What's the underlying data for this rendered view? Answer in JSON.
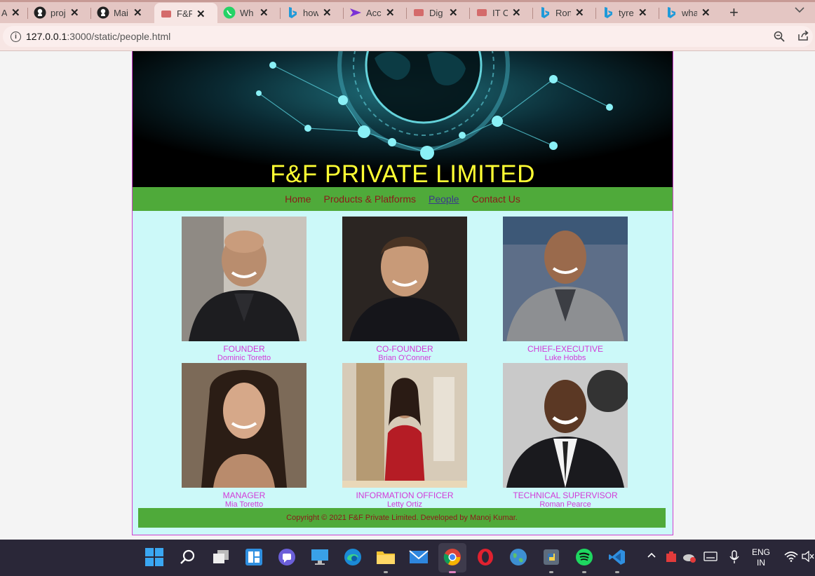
{
  "browser": {
    "tabs": [
      {
        "title": "A",
        "favicon": "generic-icon"
      },
      {
        "title": "proj",
        "favicon": "github-icon"
      },
      {
        "title": "Mai",
        "favicon": "github-icon"
      },
      {
        "title": "F&F",
        "favicon": "site-icon",
        "active": true
      },
      {
        "title": "Wh",
        "favicon": "whatsapp-icon"
      },
      {
        "title": "how",
        "favicon": "bing-icon"
      },
      {
        "title": "Acc",
        "favicon": "visual-studio-icon"
      },
      {
        "title": "Dig",
        "favicon": "site-icon"
      },
      {
        "title": "IT C",
        "favicon": "site-icon"
      },
      {
        "title": "Ron",
        "favicon": "bing-icon"
      },
      {
        "title": "tyre",
        "favicon": "bing-icon"
      },
      {
        "title": "wha",
        "favicon": "bing-icon"
      }
    ],
    "url_host": "127.0.0.1",
    "url_path": ":3000/static/people.html"
  },
  "page": {
    "company_title": "F&F PRIVATE LIMITED",
    "nav": [
      "Home",
      "Products & Platforms",
      "People",
      "Contact Us"
    ],
    "current_nav": "People",
    "people": [
      {
        "role": "FOUNDER",
        "name": "Dominic Toretto"
      },
      {
        "role": "CO-FOUNDER",
        "name": "Brian O'Conner"
      },
      {
        "role": "CHIEF-EXECUTIVE",
        "name": "Luke Hobbs"
      },
      {
        "role": "MANAGER",
        "name": "Mia Toretto"
      },
      {
        "role": "INFORMATION OFFICER",
        "name": "Letty Ortiz"
      },
      {
        "role": "TECHNICAL SUPERVISOR",
        "name": "Roman Pearce"
      }
    ],
    "footer": "Copyright © 2021 F&F Private Limited. Developed by Manoj Kumar."
  },
  "taskbar": {
    "apps": [
      "start-icon",
      "search-icon",
      "task-view-icon",
      "widgets-icon",
      "teams-chat-icon",
      "desktop-icon",
      "edge-icon",
      "file-explorer-icon",
      "mail-icon",
      "chrome-icon",
      "opera-icon",
      "globe-icon",
      "python-icon",
      "spotify-icon",
      "vscode-icon"
    ],
    "language_line1": "ENG",
    "language_line2": "IN"
  },
  "colors": {
    "title_yellow": "#ffff33",
    "nav_green": "#4faa3a",
    "nav_link": "#8b1a1a",
    "caption_pink": "#d23ad8",
    "page_bg": "#ccf9f9"
  }
}
